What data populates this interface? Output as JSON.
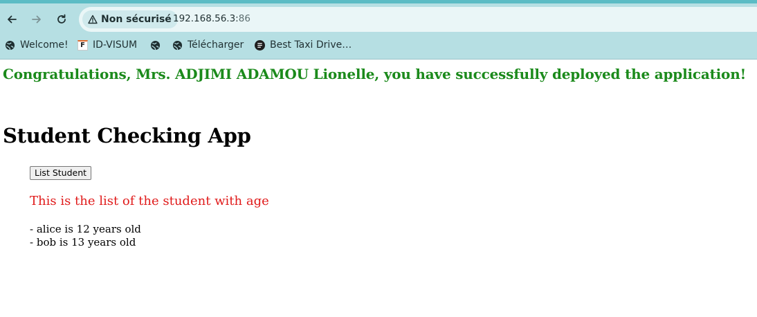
{
  "browser": {
    "security_label": "Non sécurisé",
    "url_host": "192.168.56.3:",
    "url_port": "86",
    "bookmarks": [
      {
        "label": "Welcome!",
        "icon": "globe-icon"
      },
      {
        "label": "ID-VISUM",
        "icon": "f-favicon"
      },
      {
        "label": "",
        "icon": "globe-icon"
      },
      {
        "label": "Télécharger",
        "icon": "globe-icon"
      },
      {
        "label": "Best Taxi Drive…",
        "icon": "dark-favicon"
      }
    ]
  },
  "page": {
    "congrats": "Congratulations, Mrs. ADJIMI ADAMOU Lionelle, you have successfully deployed the application!",
    "title": "Student Checking App",
    "button_label": "List Student",
    "list_heading": "This is the list of the student with age",
    "students": [
      "- alice is 12 years old",
      "- bob is 13 years old"
    ]
  },
  "colors": {
    "congrats": "#1b8a1b",
    "list_heading": "#e01a1a",
    "chrome": "#b6dfe3",
    "chrome_accent": "#5cbcc5"
  }
}
